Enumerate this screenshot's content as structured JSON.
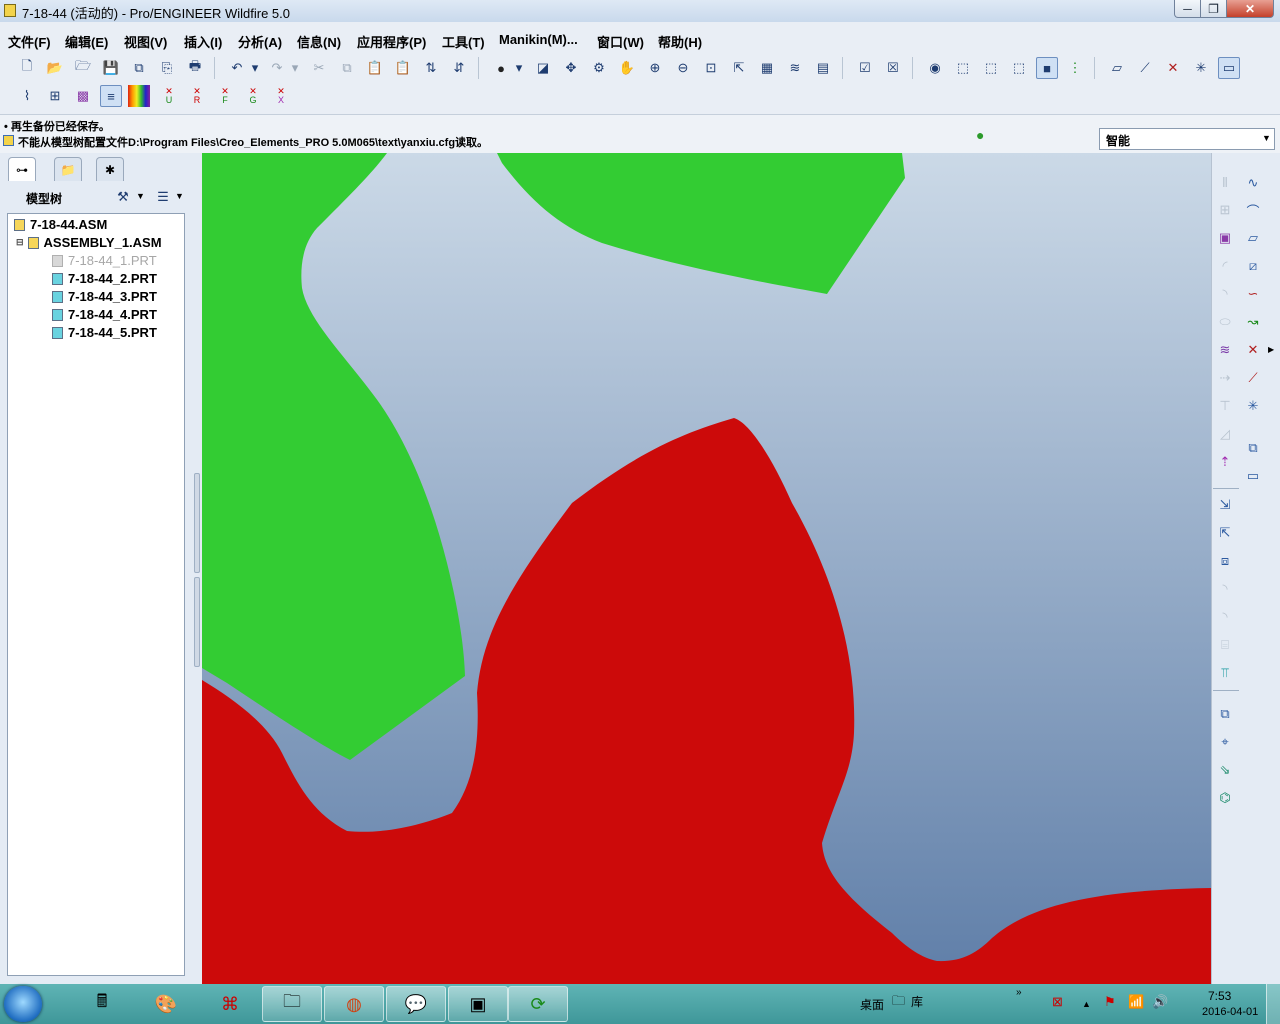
{
  "window": {
    "title": "7-18-44 (活动的) - Pro/ENGINEER Wildfire 5.0",
    "min_glyph": "─",
    "max_glyph": "❐",
    "close_glyph": "✕"
  },
  "menu": [
    "文件(F)",
    "编辑(E)",
    "视图(V)",
    "插入(I)",
    "分析(A)",
    "信息(N)",
    "应用程序(P)",
    "工具(T)",
    "Manikin(M)...",
    "窗口(W)",
    "帮助(H)"
  ],
  "toolbar_row2_labels": [
    "U",
    "R",
    "F",
    "G",
    "X"
  ],
  "messages": {
    "line1": "• 再生备份已经保存。",
    "line2": "不能从模型树配置文件D:\\Program Files\\Creo_Elements_PRO 5.0M065\\text\\yanxiu.cfg读取。"
  },
  "filter": {
    "value": "智能"
  },
  "model_tree": {
    "title": "模型树",
    "nodes": [
      {
        "label": "7-18-44.ASM",
        "type": "asm"
      },
      {
        "label": "ASSEMBLY_1.ASM",
        "type": "asm"
      },
      {
        "label": "7-18-44_1.PRT",
        "type": "prt-hidden"
      },
      {
        "label": "7-18-44_2.PRT",
        "type": "prt"
      },
      {
        "label": "7-18-44_3.PRT",
        "type": "prt"
      },
      {
        "label": "7-18-44_4.PRT",
        "type": "prt"
      },
      {
        "label": "7-18-44_5.PRT",
        "type": "prt"
      }
    ]
  },
  "graphics": {
    "background_top": "#cbd9e7",
    "background_bottom": "#5f7ea8",
    "part_green": "#33cc33",
    "part_red": "#cc0a0a"
  },
  "taskbar": {
    "desktop_label": "桌面",
    "library_label": "库",
    "time": "7:53",
    "date": "2016-04-01"
  }
}
